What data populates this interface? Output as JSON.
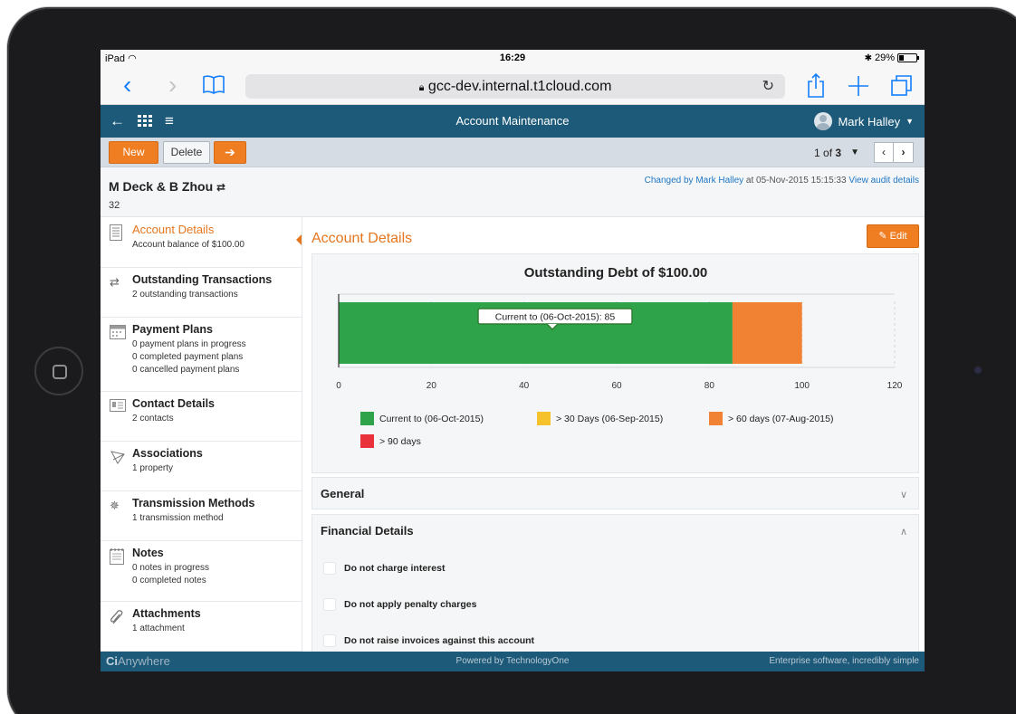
{
  "status_bar": {
    "device": "iPad",
    "time": "16:29",
    "battery": "29%",
    "battery_level": 0.29
  },
  "browser": {
    "url": "gcc-dev.internal.t1cloud.com"
  },
  "app_header": {
    "title": "Account Maintenance",
    "user": "Mark Halley"
  },
  "toolbar": {
    "new_label": "New",
    "delete_label": "Delete",
    "pager_prefix": "1 of ",
    "pager_total": "3"
  },
  "record": {
    "name": "M Deck & B Zhou",
    "number": "32",
    "audit_prefix": "Changed by ",
    "audit_user": "Mark Halley",
    "audit_at": " at 05-Nov-2015 15:15:33 ",
    "audit_link": "View audit details"
  },
  "sidebar": {
    "items": [
      {
        "title": "Account Details",
        "lines": [
          "Account balance of $100.00"
        ],
        "icon": "document-list-icon"
      },
      {
        "title": "Outstanding Transactions",
        "lines": [
          "2 outstanding transactions"
        ],
        "icon": "transfer-arrows-icon"
      },
      {
        "title": "Payment Plans",
        "lines": [
          "0 payment plans in progress",
          "0 completed payment plans",
          "0 cancelled payment plans"
        ],
        "icon": "calendar-icon"
      },
      {
        "title": "Contact Details",
        "lines": [
          "2 contacts"
        ],
        "icon": "contact-card-icon"
      },
      {
        "title": "Associations",
        "lines": [
          "1 property"
        ],
        "icon": "network-icon"
      },
      {
        "title": "Transmission Methods",
        "lines": [
          "1 transmission method"
        ],
        "icon": "transmission-icon"
      },
      {
        "title": "Notes",
        "lines": [
          "0 notes in progress",
          "0 completed notes"
        ],
        "icon": "notepad-icon"
      },
      {
        "title": "Attachments",
        "lines": [
          "1 attachment"
        ],
        "icon": "paperclip-icon"
      }
    ]
  },
  "main": {
    "title": "Account Details",
    "edit_label": "Edit",
    "sections": {
      "general": "General",
      "financial": "Financial Details"
    },
    "checkboxes": [
      "Do not charge interest",
      "Do not apply penalty charges",
      "Do not raise invoices against this account"
    ]
  },
  "chart_data": {
    "type": "bar",
    "orientation": "horizontal-stacked",
    "title": "Outstanding Debt of $100.00",
    "xlim": [
      0,
      120
    ],
    "xticks": [
      0,
      20,
      40,
      60,
      80,
      100,
      120
    ],
    "series": [
      {
        "name": "Current to (06-Oct-2015)",
        "value": 85,
        "color": "#2ea34a"
      },
      {
        "name": "> 30 Days (06-Sep-2015)",
        "value": 0,
        "color": "#f5c22b"
      },
      {
        "name": "> 60 days (07-Aug-2015)",
        "value": 15,
        "color": "#f28233"
      },
      {
        "name": "> 90 days",
        "value": 0,
        "color": "#e8313a"
      }
    ],
    "tooltip": "Current to (06-Oct-2015): 85",
    "grid": true,
    "legend": "bottom"
  },
  "footer": {
    "brand_ci": "Ci",
    "brand_rest": "Anywhere",
    "center": "Powered by TechnologyOne",
    "right": "Enterprise software, incredibly simple"
  }
}
